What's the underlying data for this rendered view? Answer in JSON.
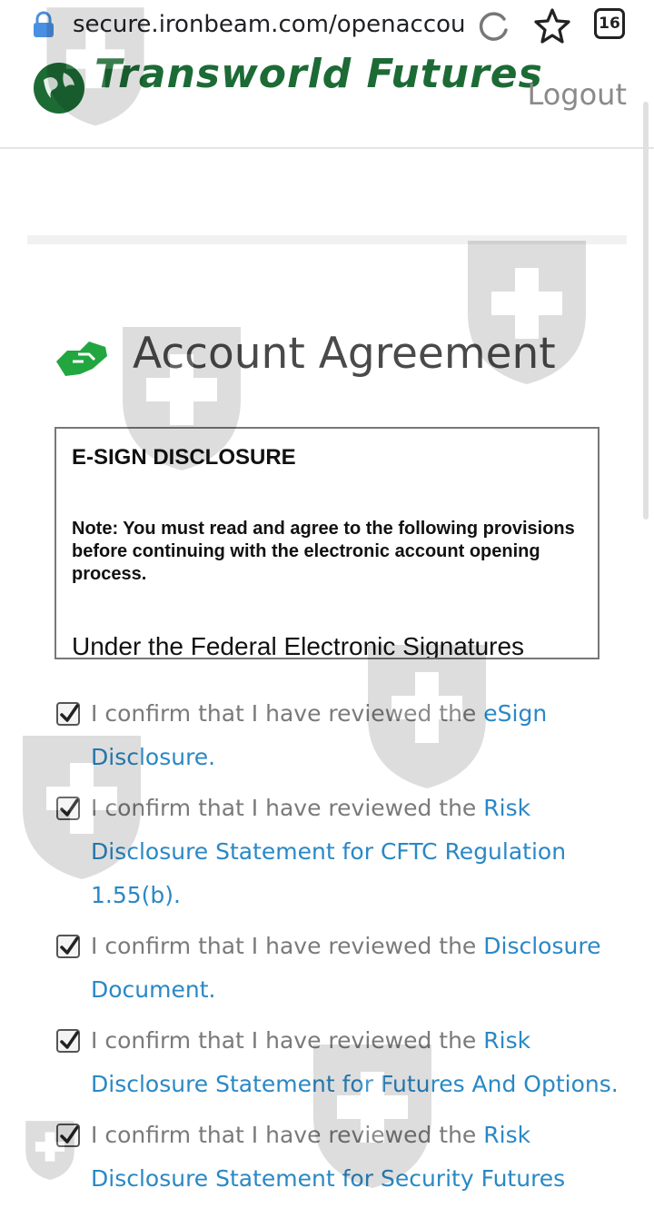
{
  "browser": {
    "url": "secure.ironbeam.com/openaccou",
    "tab_count": "16"
  },
  "header": {
    "logo_text": "Transworld Futures",
    "logout_label": "Logout"
  },
  "page": {
    "title": "Account Agreement"
  },
  "disclosure": {
    "heading": "E-SIGN DISCLOSURE",
    "note": "Note: You must read and agree to the following provisions before continuing with the electronic account opening process.",
    "paragraph_start": "Under the Federal Electronic Signatures"
  },
  "confirmations": [
    {
      "text": "I confirm that I have reviewed the ",
      "link": "eSign Disclosure.",
      "checked": true
    },
    {
      "text": "I confirm that I have reviewed the ",
      "link": "Risk Disclosure Statement for CFTC Regulation 1.55(b).",
      "checked": true
    },
    {
      "text": "I confirm that I have reviewed the ",
      "link": "Disclosure Document.",
      "checked": true
    },
    {
      "text": "I confirm that I have reviewed the ",
      "link": "Risk Disclosure Statement for Futures And Options.",
      "checked": true
    },
    {
      "text": "I confirm that I have reviewed the ",
      "link": "Risk Disclosure Statement for Security Futures",
      "checked": true
    }
  ],
  "colors": {
    "link": "#2a88c5",
    "brand_green": "#1c6b35",
    "icon_green": "#22a640"
  }
}
